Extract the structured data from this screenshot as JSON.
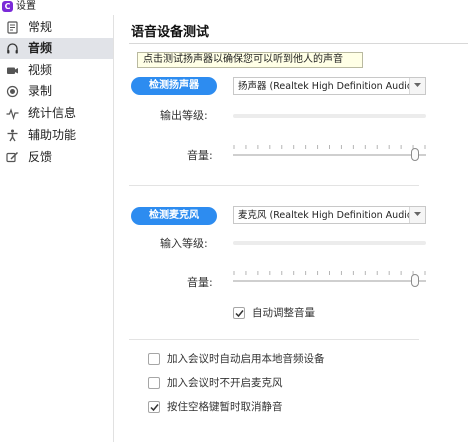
{
  "window": {
    "title": "设置",
    "app_icon_letter": "C"
  },
  "sidebar": {
    "items": [
      {
        "label": "常规",
        "icon": "settings-icon",
        "active": false
      },
      {
        "label": "音频",
        "icon": "headphones-icon",
        "active": true
      },
      {
        "label": "视频",
        "icon": "video-camera-icon",
        "active": false
      },
      {
        "label": "录制",
        "icon": "record-icon",
        "active": false
      },
      {
        "label": "统计信息",
        "icon": "statistics-icon",
        "active": false
      },
      {
        "label": "辅助功能",
        "icon": "accessibility-icon",
        "active": false
      },
      {
        "label": "反馈",
        "icon": "feedback-icon",
        "active": false
      }
    ]
  },
  "main": {
    "title": "语音设备测试",
    "tooltip": "点击测试扬声器以确保您可以听到他人的声音",
    "speaker": {
      "test_button": "检测扬声器",
      "device": "扬声器 (Realtek High Definition Audio)",
      "output_level_label": "输出等级:",
      "output_level": 0,
      "volume_label": "音量:",
      "volume": 0.96
    },
    "microphone": {
      "test_button": "检测麦克风",
      "device": "麦克风 (Realtek High Definition Audio)",
      "input_level_label": "输入等级:",
      "input_level": 0,
      "volume_label": "音量:",
      "volume": 0.96,
      "auto_adjust": {
        "label": "自动调整音量",
        "checked": true
      }
    },
    "options": [
      {
        "label": "加入会议时自动启用本地音频设备",
        "checked": false
      },
      {
        "label": "加入会议时不开启麦克风",
        "checked": false
      },
      {
        "label": "按住空格键暂时取消静音",
        "checked": true
      }
    ]
  },
  "colors": {
    "accent": "#2d8cf0",
    "brand": "#7a2ad8",
    "active_nav": "#e1e3e8",
    "tooltip_bg": "#ffffe6"
  }
}
